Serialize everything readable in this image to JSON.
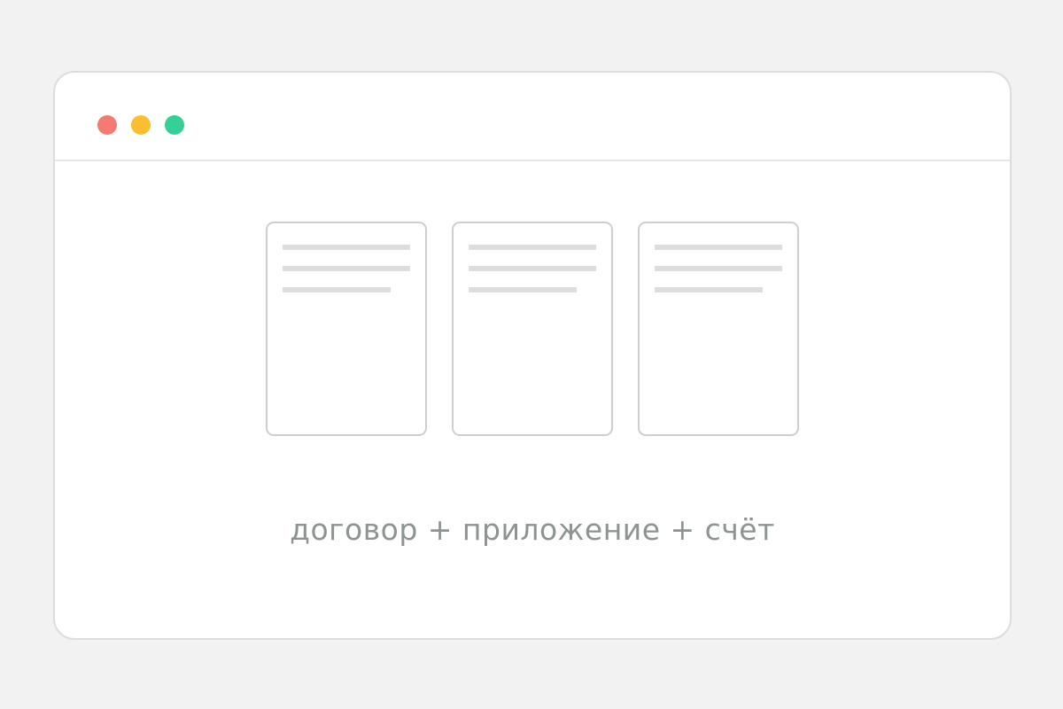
{
  "window": {
    "controls": {
      "close": {
        "icon": "close-dot-icon",
        "color": "#f47a72"
      },
      "minimize": {
        "icon": "minimize-dot-icon",
        "color": "#fbbe2e"
      },
      "maximize": {
        "icon": "maximize-dot-icon",
        "color": "#36cf95"
      }
    }
  },
  "documents": [
    {
      "icon": "document-icon"
    },
    {
      "icon": "document-icon"
    },
    {
      "icon": "document-icon"
    }
  ],
  "caption": "договор + приложение + счёт"
}
